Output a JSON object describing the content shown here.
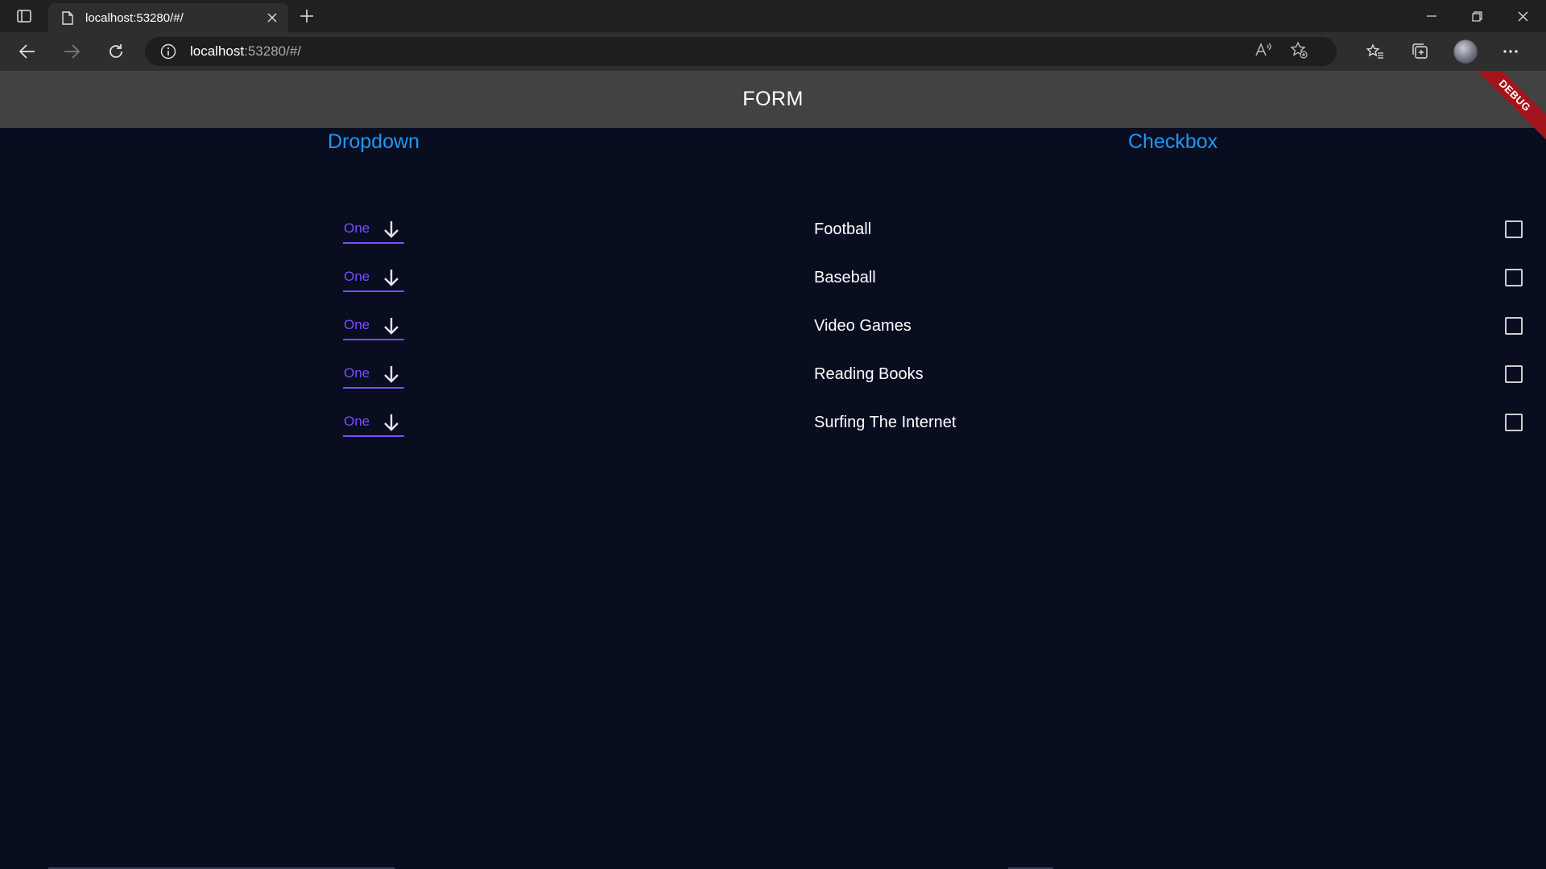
{
  "browser": {
    "tab_title": "localhost:53280/#/",
    "url_host": "localhost",
    "url_rest": ":53280/#/"
  },
  "app": {
    "title": "FORM",
    "debug_banner": "DEBUG"
  },
  "dropdown": {
    "heading": "Dropdown",
    "items": [
      {
        "value": "One"
      },
      {
        "value": "One"
      },
      {
        "value": "One"
      },
      {
        "value": "One"
      },
      {
        "value": "One"
      }
    ]
  },
  "checkbox": {
    "heading": "Checkbox",
    "items": [
      {
        "label": "Football",
        "checked": false
      },
      {
        "label": "Baseball",
        "checked": false
      },
      {
        "label": "Video Games",
        "checked": false
      },
      {
        "label": "Reading Books",
        "checked": false
      },
      {
        "label": "Surfing The Internet",
        "checked": false
      }
    ]
  },
  "colors": {
    "accent_blue": "#2196f3",
    "dropdown_purple": "#7c4dff",
    "background": "#080d20",
    "appbar": "#424242",
    "debug_red": "#a4141c"
  }
}
